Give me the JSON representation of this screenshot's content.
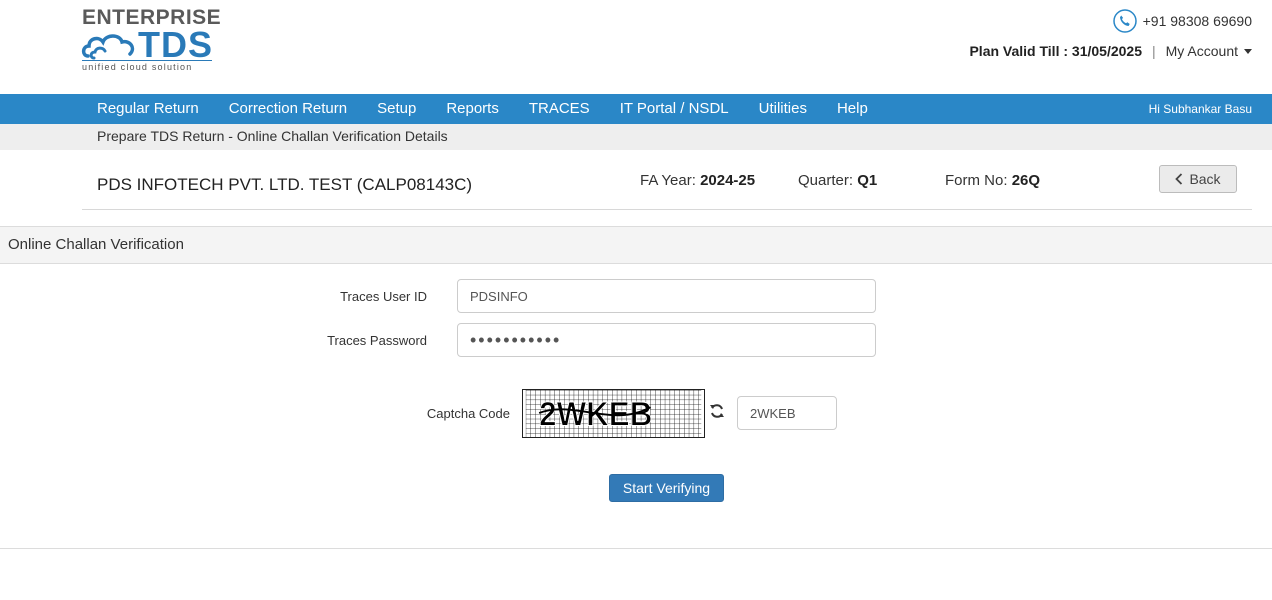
{
  "brand": {
    "top": "ENTERPRISE",
    "name": "TDS",
    "tagline": "unified cloud solution"
  },
  "header": {
    "phone": "+91 98308 69690",
    "plan_valid": "Plan Valid Till : 31/05/2025",
    "separator": "|",
    "my_account": "My Account"
  },
  "nav": {
    "items": [
      "Regular Return",
      "Correction Return",
      "Setup",
      "Reports",
      "TRACES",
      "IT Portal / NSDL",
      "Utilities",
      "Help"
    ],
    "user_greeting": "Hi Subhankar Basu"
  },
  "breadcrumb": "Prepare TDS Return - Online Challan Verification Details",
  "info": {
    "company": "PDS INFOTECH PVT. LTD. TEST (CALP08143C)",
    "fa_year_label": "FA Year:",
    "fa_year": "2024-25",
    "quarter_label": "Quarter:",
    "quarter": "Q1",
    "form_label": "Form No:",
    "form_no": "26Q",
    "back": "Back"
  },
  "section_title": "Online Challan Verification",
  "form": {
    "user_id_label": "Traces User ID",
    "user_id_value": "PDSINFO",
    "password_label": "Traces Password",
    "password_value": "•••••••••••",
    "captcha_label": "Captcha Code",
    "captcha_text": "2WKEB",
    "captcha_value": "2WKEB",
    "submit": "Start Verifying"
  },
  "colors": {
    "nav": "#2a87c7",
    "brand_blue": "#2a7ab8",
    "primary_button": "#337ab7"
  }
}
